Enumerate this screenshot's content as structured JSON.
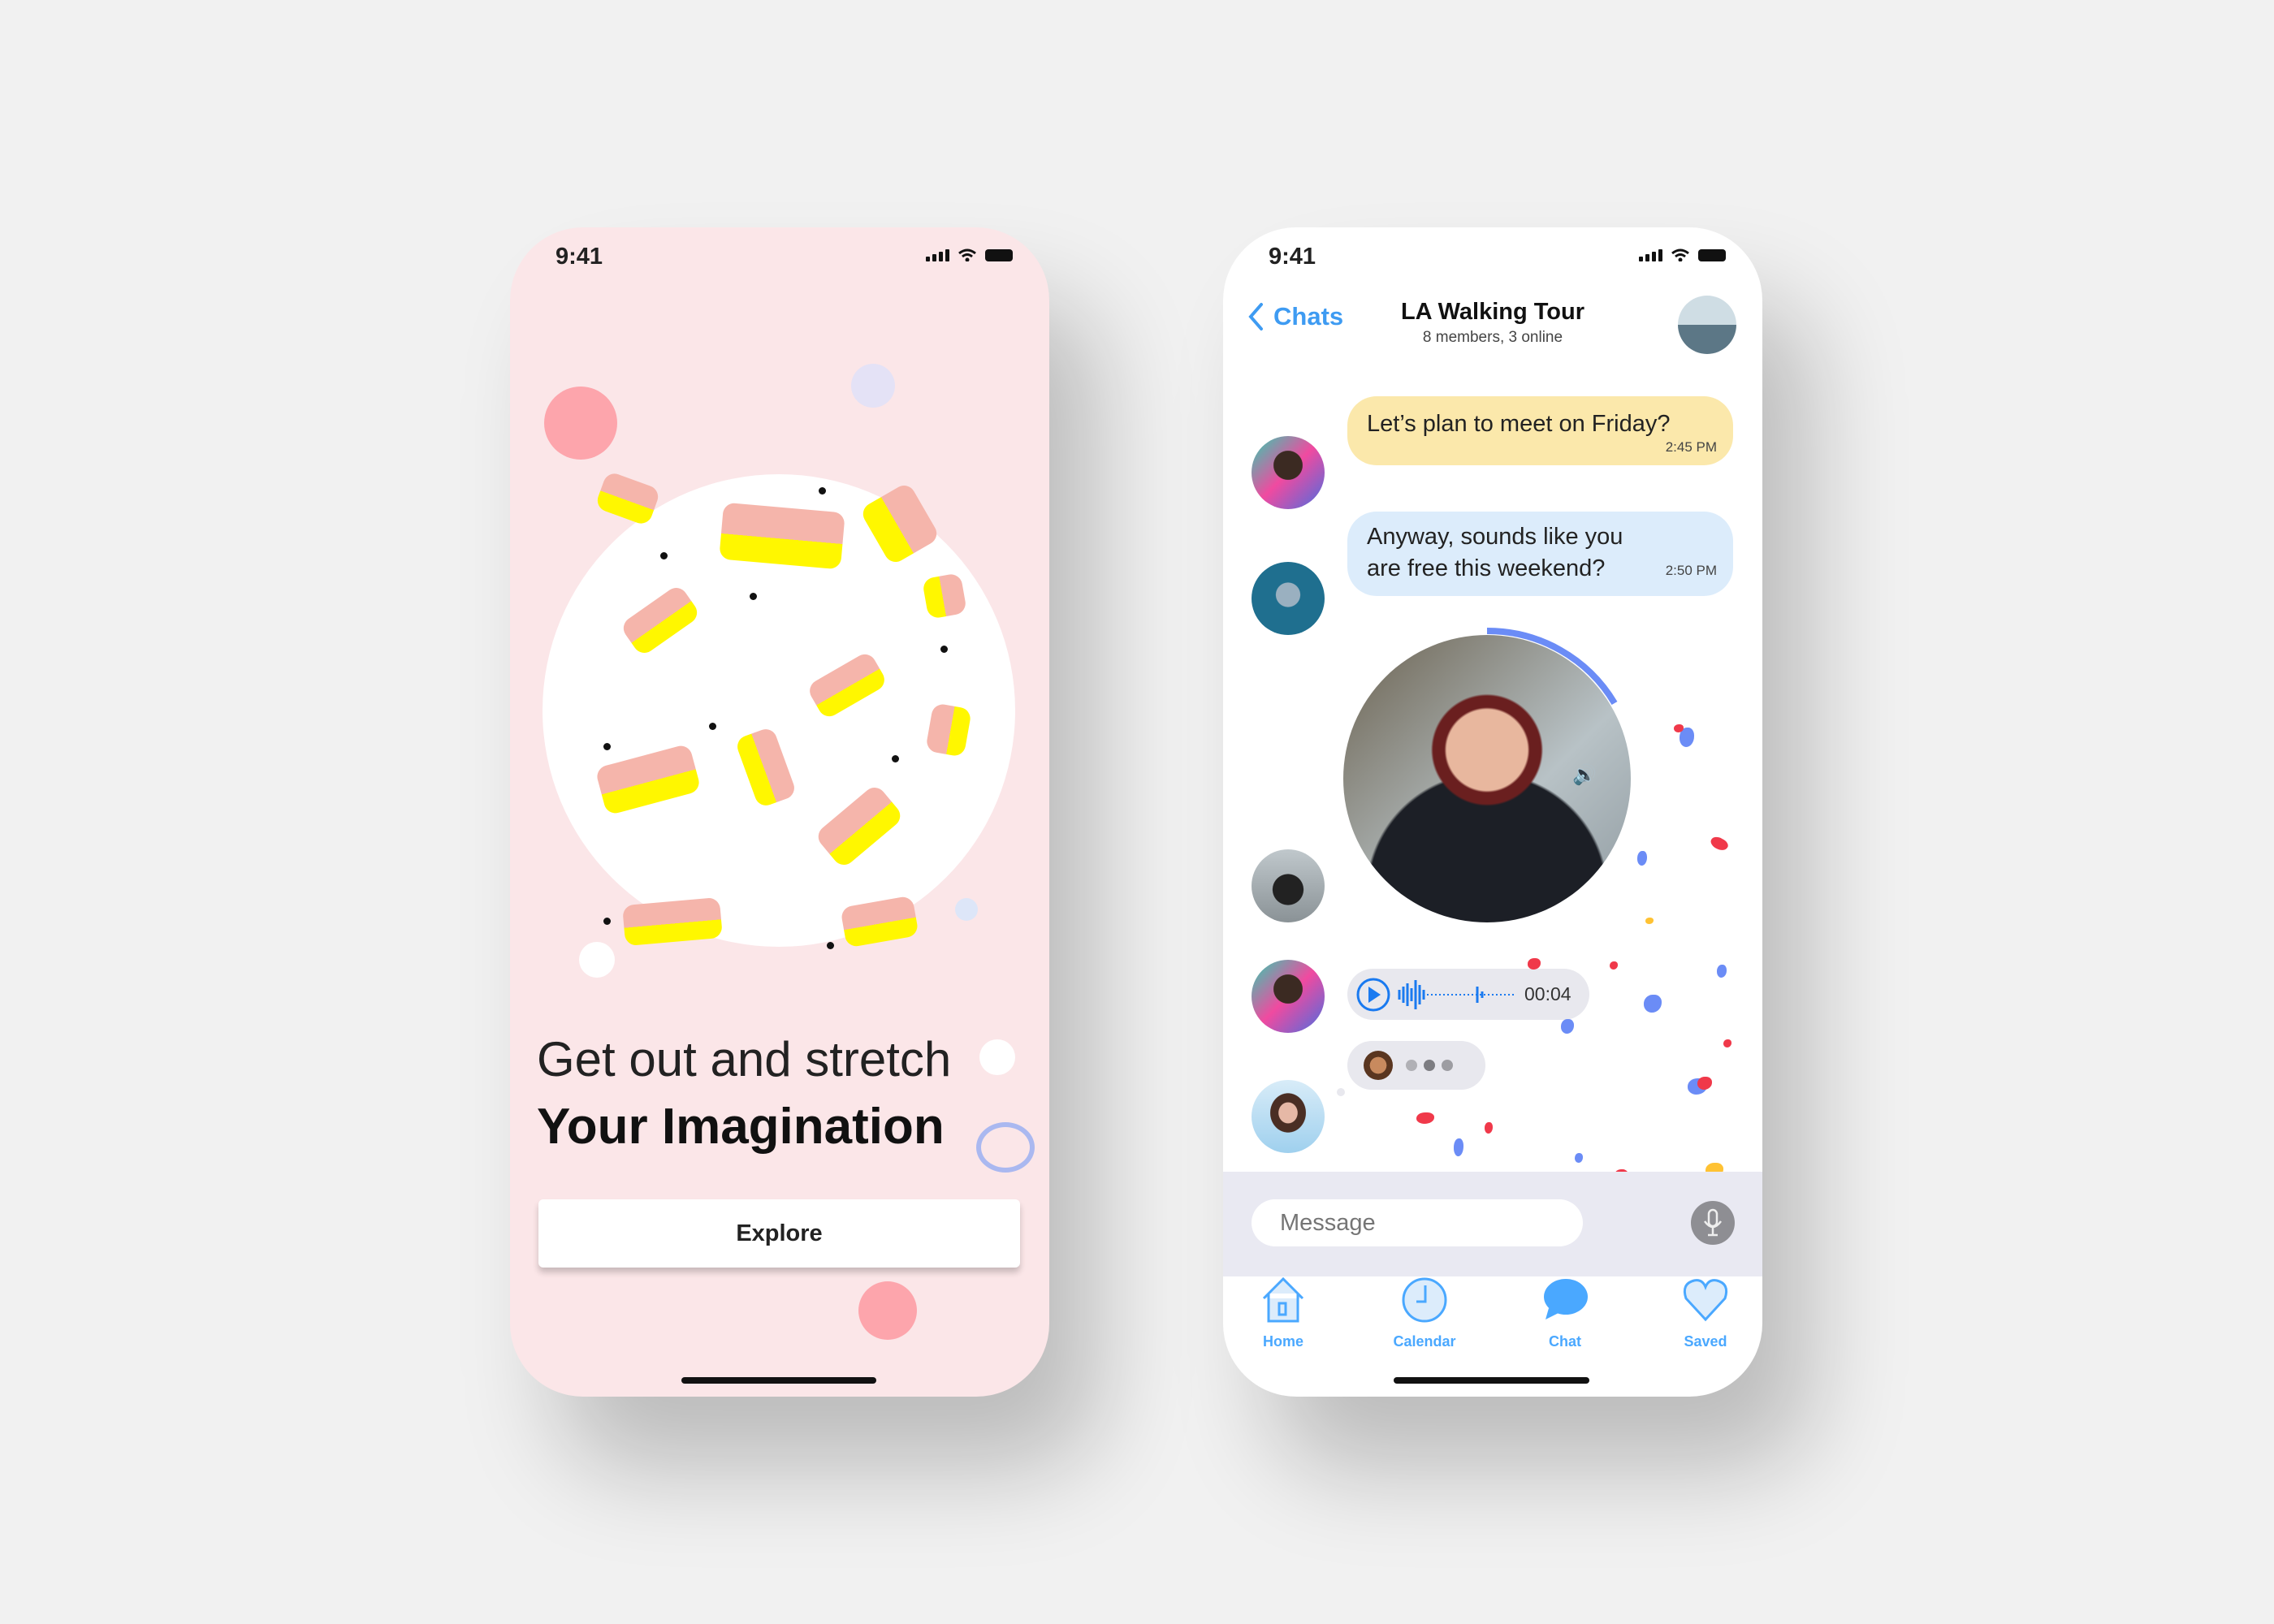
{
  "left_screen": {
    "status_time": "9:41",
    "headline_light": "Get out and stretch",
    "headline_bold": "Your Imagination",
    "explore_button": "Explore"
  },
  "right_screen": {
    "status_time": "9:41",
    "back_label": "Chats",
    "chat_title": "LA Walking Tour",
    "chat_subtitle": "8 members, 3 online",
    "messages": [
      {
        "text": "Let’s plan to meet on Friday?",
        "time": "2:45 PM"
      },
      {
        "text": "Anyway, sounds like you are free this weekend?",
        "time": "2:50 PM"
      }
    ],
    "voice_duration": "00:04",
    "message_placeholder": "Message",
    "tabs": [
      {
        "label": "Home",
        "icon": "home-icon"
      },
      {
        "label": "Calendar",
        "icon": "clock-icon"
      },
      {
        "label": "Chat",
        "icon": "chat-bubble-icon"
      },
      {
        "label": "Saved",
        "icon": "heart-icon"
      }
    ],
    "colors": {
      "accent": "#4aa8ff",
      "yellow_bubble": "#fbe8ab",
      "blue_bubble": "#dcecfb"
    }
  }
}
